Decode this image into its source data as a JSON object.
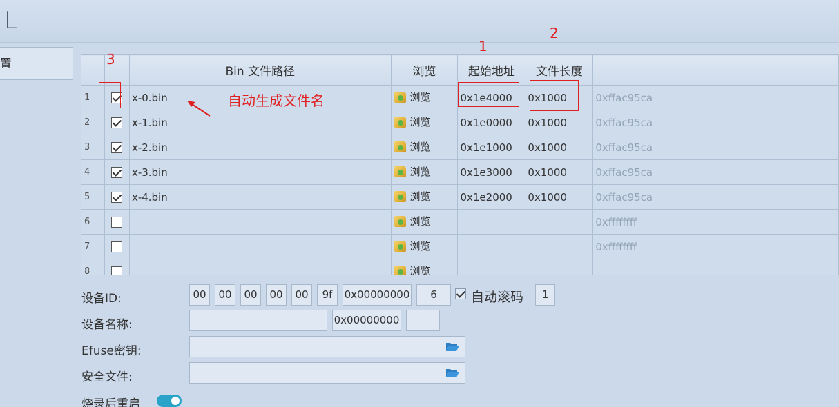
{
  "window": {
    "title_fragment": "IL"
  },
  "sidebar": {
    "tab_label": "置"
  },
  "table": {
    "headers": [
      "",
      "",
      "Bin 文件路径",
      "浏览",
      "起始地址",
      "文件长度",
      ""
    ],
    "rows": [
      {
        "index": "1",
        "checked": true,
        "path": "x-0.bin",
        "browse": "浏览",
        "addr": "0x1e4000",
        "len": "0x1000",
        "crc": "0xffac95ca"
      },
      {
        "index": "2",
        "checked": true,
        "path": "x-1.bin",
        "browse": "浏览",
        "addr": "0x1e0000",
        "len": "0x1000",
        "crc": "0xffac95ca"
      },
      {
        "index": "3",
        "checked": true,
        "path": "x-2.bin",
        "browse": "浏览",
        "addr": "0x1e1000",
        "len": "0x1000",
        "crc": "0xffac95ca"
      },
      {
        "index": "4",
        "checked": true,
        "path": "x-3.bin",
        "browse": "浏览",
        "addr": "0x1e3000",
        "len": "0x1000",
        "crc": "0xffac95ca"
      },
      {
        "index": "5",
        "checked": true,
        "path": "x-4.bin",
        "browse": "浏览",
        "addr": "0x1e2000",
        "len": "0x1000",
        "crc": "0xffac95ca"
      },
      {
        "index": "6",
        "checked": false,
        "path": "",
        "browse": "浏览",
        "addr": "",
        "len": "",
        "crc": "0xffffffff"
      },
      {
        "index": "7",
        "checked": false,
        "path": "",
        "browse": "浏览",
        "addr": "",
        "len": "",
        "crc": "0xffffffff"
      },
      {
        "index": "8",
        "checked": false,
        "path": "",
        "browse": "浏览",
        "addr": "",
        "len": "",
        "crc": ""
      }
    ]
  },
  "annotations": {
    "num1": "1",
    "num2": "2",
    "num3": "3",
    "note": "自动生成文件名"
  },
  "form": {
    "device_id_label": "设备ID:",
    "device_id_bytes": [
      "00",
      "00",
      "00",
      "00",
      "00",
      "9f"
    ],
    "device_id_hex": "0x00000000",
    "device_id_count": "6",
    "auto_roll_label": "自动滚码",
    "auto_roll_value": "1",
    "device_name_label": "设备名称:",
    "device_name_value": "",
    "device_name_hex": "0x00000000",
    "device_name_extra": "",
    "efuse_label": "Efuse密钥:",
    "efuse_value": "",
    "security_label": "安全文件:",
    "security_value": "",
    "restart_label": "烧录后重启",
    "restart_on": true
  },
  "colors": {
    "annotation": "#e02020",
    "toggle": "#2aa3c8"
  }
}
